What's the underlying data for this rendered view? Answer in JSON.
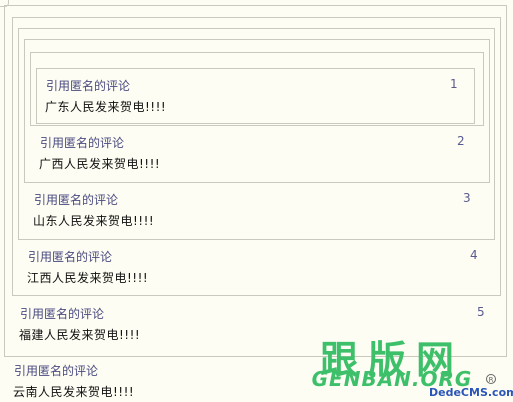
{
  "comments": [
    {
      "level": 1,
      "header": "引用匿名的评论",
      "number": "1",
      "content": "广东人民发来贺电!!!!"
    },
    {
      "level": 2,
      "header": "引用匿名的评论",
      "number": "2",
      "content": "广西人民发来贺电!!!!"
    },
    {
      "level": 3,
      "header": "引用匿名的评论",
      "number": "3",
      "content": "山东人民发来贺电!!!!"
    },
    {
      "level": 4,
      "header": "引用匿名的评论",
      "number": "4",
      "content": "江西人民发来贺电!!!!"
    },
    {
      "level": 5,
      "header": "引用匿名的评论",
      "number": "5",
      "content": "福建人民发来贺电!!!!"
    },
    {
      "level": 6,
      "header": "引用匿名的评论",
      "content": "云南人民发来贺电!!!!"
    }
  ],
  "watermark": {
    "chinese": "跟版网",
    "latin": "GENBAN.ORG",
    "reg": "R",
    "cms": "DedeCMS.com",
    "color": "#3ec06a"
  }
}
